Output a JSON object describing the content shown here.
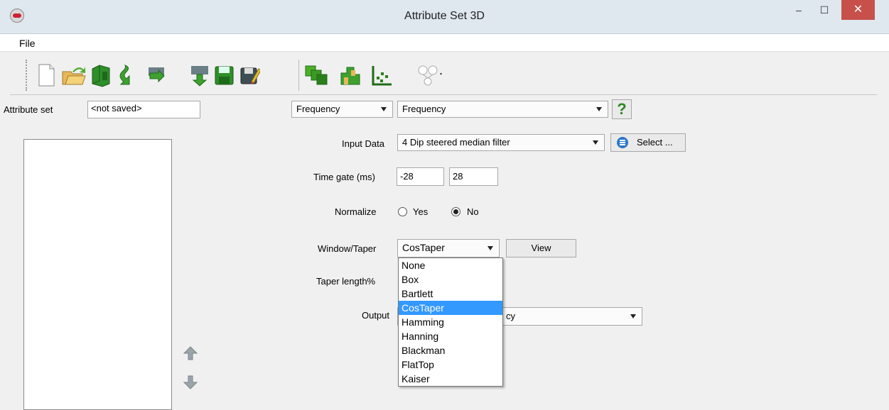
{
  "window": {
    "title": "Attribute Set 3D",
    "minimize": "‒",
    "maximize": "☐",
    "close": "✕"
  },
  "menu": {
    "file": "File"
  },
  "toolbar": {
    "icons": [
      "new-icon",
      "open-icon",
      "save-set-icon",
      "import-icon",
      "reload-icon",
      "save-icon",
      "save-as-icon",
      "evaluate-icon",
      "crossplot-icon",
      "graph-icon",
      "network-icon"
    ]
  },
  "attribute_set": {
    "label": "Attribute set",
    "value": "<not saved>"
  },
  "type_select": {
    "category": "Frequency",
    "attribute": "Frequency",
    "help": "?"
  },
  "input_data": {
    "label": "Input Data",
    "value": "4 Dip steered median filter",
    "select_button": "Select ..."
  },
  "time_gate": {
    "label": "Time gate (ms)",
    "start": "-28",
    "stop": "28"
  },
  "normalize": {
    "label": "Normalize",
    "yes": "Yes",
    "no": "No",
    "selected": "No"
  },
  "window_taper": {
    "label": "Window/Taper",
    "value": "CosTaper",
    "view_button": "View",
    "options": [
      "None",
      "Box",
      "Bartlett",
      "CosTaper",
      "Hamming",
      "Hanning",
      "Blackman",
      "FlatTop",
      "Kaiser"
    ],
    "selected_index": 3
  },
  "taper_length": {
    "label": "Taper length%"
  },
  "output": {
    "label": "Output",
    "value_fragment": "cy"
  },
  "colors": {
    "selection": "#3399ff",
    "close_button": "#c7504a",
    "help_icon": "#2d8a1f"
  }
}
